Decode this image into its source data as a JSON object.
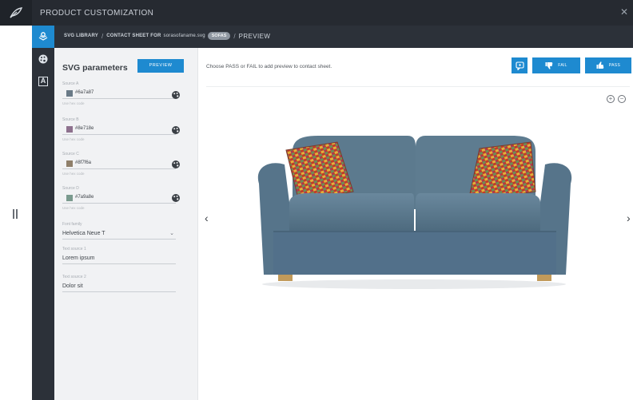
{
  "app": {
    "title": "PRODUCT CUSTOMIZATION"
  },
  "breadcrumb": {
    "library": "SVG LIBRARY",
    "sheet_prefix": "CONTACT SHEET FOR",
    "sheet_file": "sorasofaname.svg",
    "badge": "SOFAS",
    "current": "PREVIEW"
  },
  "panel": {
    "title": "SVG parameters",
    "preview_label": "PREVIEW",
    "colors": [
      {
        "label": "Source A",
        "value": "#6a7a87",
        "help": "Use hex code",
        "swatch": "#6a7a87"
      },
      {
        "label": "Source B",
        "value": "#8e718e",
        "help": "Use hex code",
        "swatch": "#8e718e"
      },
      {
        "label": "Source C",
        "value": "#8f7f6a",
        "help": "Use hex code",
        "swatch": "#8f7f6a"
      },
      {
        "label": "Source D",
        "value": "#7a9a8e",
        "help": "Use hex code",
        "swatch": "#7a9a8e"
      }
    ],
    "font_field": {
      "label": "Font family",
      "value": "Helvetica Neue T"
    },
    "text_field_1": {
      "label": "Text source 1",
      "value": "Lorem ipsum"
    },
    "text_field_2": {
      "label": "Text source 2",
      "value": "Dolor sit"
    }
  },
  "main": {
    "instruction": "Choose PASS or FAIL to add preview to contact sheet.",
    "fail_label": "FAIL",
    "pass_label": "PASS"
  },
  "icons": {
    "logo": "feather-icon",
    "rail": [
      "layers-icon",
      "palette-icon",
      "text-icon"
    ],
    "zoom": [
      "zoom-in-icon",
      "zoom-out-icon"
    ]
  },
  "colors": {
    "accent": "#1e8ad0",
    "chrome_dark": "#262a31",
    "rail": "#2c3139",
    "sofa": "#5d7a8f"
  }
}
